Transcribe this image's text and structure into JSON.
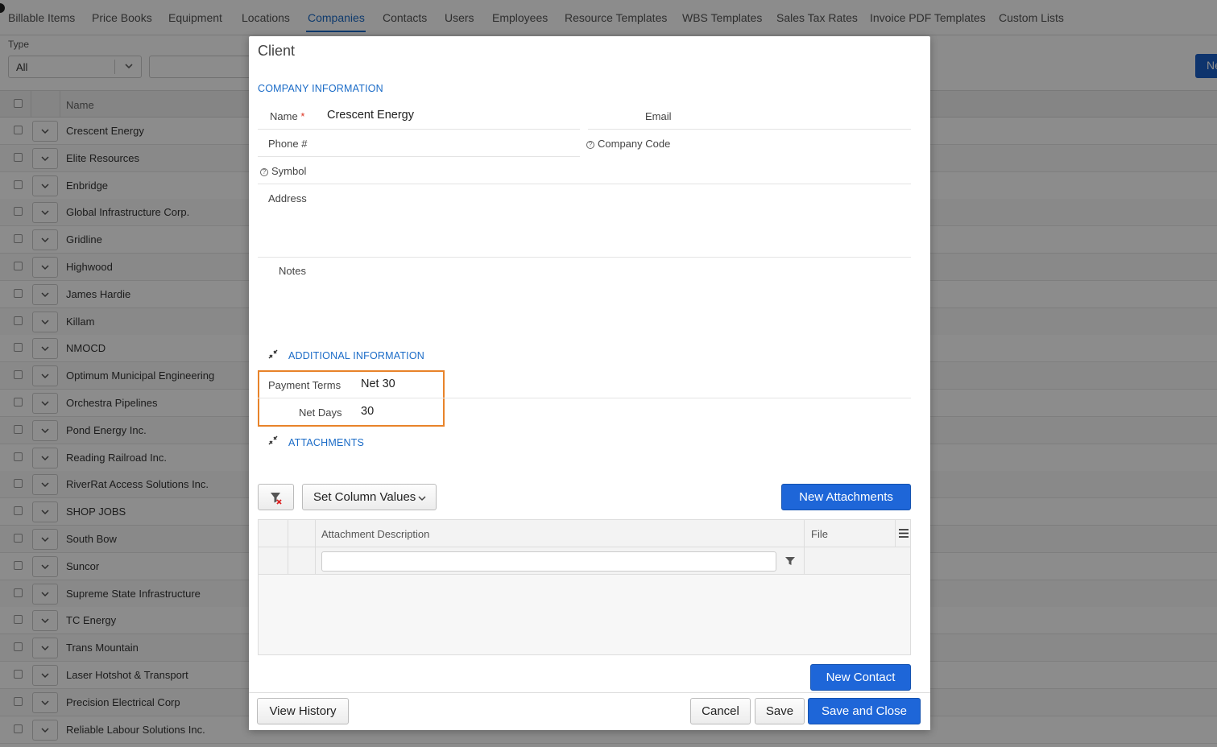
{
  "nav": {
    "tabs": [
      "Billable Items",
      "Price Books",
      "Equipment",
      "Locations",
      "Companies",
      "Contacts",
      "Users",
      "Employees",
      "Resource Templates",
      "WBS Templates",
      "Sales Tax Rates",
      "Invoice PDF Templates",
      "Custom Lists"
    ],
    "active_tab": "Companies"
  },
  "filters": {
    "type_label": "Type",
    "type_value": "All",
    "new_button_label": "Ne"
  },
  "grid": {
    "name_header": "Name",
    "rows": [
      "Crescent Energy",
      "Elite Resources",
      "Enbridge",
      "Global Infrastructure Corp.",
      "Gridline",
      "Highwood",
      "James Hardie",
      "Killam",
      "NMOCD",
      "Optimum Municipal Engineering",
      "Orchestra Pipelines",
      "Pond Energy Inc.",
      "Reading Railroad Inc.",
      "RiverRat Access Solutions Inc.",
      "SHOP JOBS",
      "South Bow",
      "Suncor",
      "Supreme State Infrastructure",
      "TC Energy",
      "Trans Mountain",
      "Laser Hotshot & Transport",
      "Precision Electrical Corp",
      "Reliable Labour Solutions Inc."
    ]
  },
  "modal": {
    "title": "Client",
    "company_section": "COMPANY INFORMATION",
    "fields": {
      "name_label": "Name",
      "name_required": "*",
      "name_value": "Crescent Energy",
      "email_label": "Email",
      "phone_label": "Phone #",
      "company_code_label": "Company Code",
      "symbol_label": "Symbol",
      "address_label": "Address",
      "notes_label": "Notes"
    },
    "additional_section": "ADDITIONAL INFORMATION",
    "additional": {
      "payment_terms_label": "Payment Terms",
      "payment_terms_value": "Net 30",
      "net_days_label": "Net Days",
      "net_days_value": "30"
    },
    "attachments_section": "ATTACHMENTS",
    "attachments": {
      "set_column_values": "Set Column Values",
      "new_attachments": "New Attachments",
      "col_description": "Attachment Description",
      "col_file": "File"
    },
    "new_contact": "New Contact",
    "footer": {
      "view_history": "View History",
      "cancel": "Cancel",
      "save": "Save",
      "save_and_close": "Save and Close"
    }
  }
}
